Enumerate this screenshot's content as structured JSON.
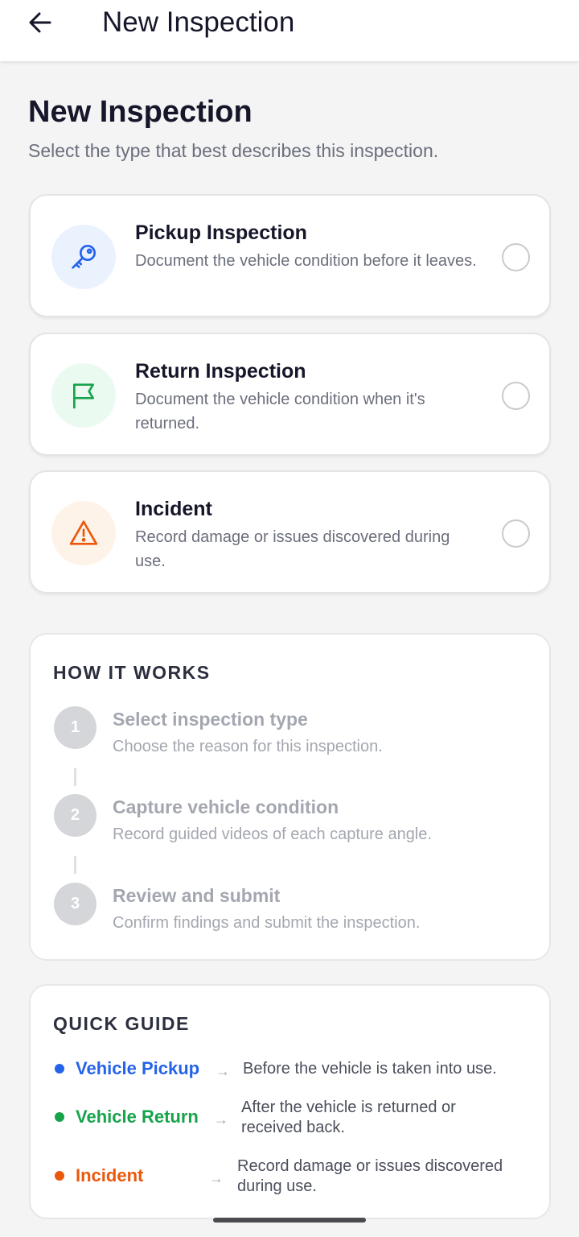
{
  "appbar": {
    "title": "New Inspection"
  },
  "header": {
    "title": "New Inspection",
    "subtitle": "Select the type that best describes this inspection."
  },
  "options": [
    {
      "title": "Pickup Inspection",
      "description": "Document the vehicle condition before it leaves.",
      "icon": "key-icon",
      "icon_color": "#2563eb",
      "icon_bg": "#eaf2fe",
      "selected": false
    },
    {
      "title": "Return Inspection",
      "description": "Document the vehicle condition when it's returned.",
      "icon": "flag-icon",
      "icon_color": "#16a34a",
      "icon_bg": "#eafaf0",
      "selected": false
    },
    {
      "title": "Incident",
      "description": "Record damage or issues discovered during use.",
      "icon": "warning-icon",
      "icon_color": "#ea580c",
      "icon_bg": "#fef3e8",
      "selected": false
    }
  ],
  "how_it_works": {
    "heading": "HOW IT WORKS",
    "steps": [
      {
        "number": "1",
        "title": "Select inspection type",
        "description": "Choose the reason for this inspection."
      },
      {
        "number": "2",
        "title": "Capture vehicle condition",
        "description": "Record guided videos of each capture angle."
      },
      {
        "number": "3",
        "title": "Review and submit",
        "description": "Confirm findings and submit the inspection."
      }
    ]
  },
  "quick_guide": {
    "heading": "QUICK GUIDE",
    "arrow": "→",
    "items": [
      {
        "label": "Vehicle Pickup",
        "description": "Before the vehicle is taken into use.",
        "color": "#2563eb"
      },
      {
        "label": "Vehicle Return",
        "description": "After the vehicle is returned or received back.",
        "color": "#16a34a"
      },
      {
        "label": "Incident",
        "description": "Record damage or issues discovered during use.",
        "color": "#ea580c"
      }
    ]
  }
}
